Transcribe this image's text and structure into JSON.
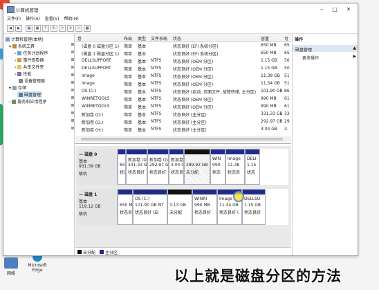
{
  "window": {
    "title": "计算机管理",
    "menu": [
      "文件(F)",
      "操作(A)",
      "查看(V)",
      "帮助(H)"
    ]
  },
  "tree": {
    "root": "计算机管理(本地)",
    "items": [
      {
        "label": "系统工具",
        "indent": 1
      },
      {
        "label": "任务计划程序",
        "indent": 2
      },
      {
        "label": "事件查看器",
        "indent": 2
      },
      {
        "label": "共享文件夹",
        "indent": 2
      },
      {
        "label": "性能",
        "indent": 2
      },
      {
        "label": "设备管理器",
        "indent": 2
      },
      {
        "label": "存储",
        "indent": 1
      },
      {
        "label": "磁盘管理",
        "indent": 2,
        "selected": true
      },
      {
        "label": "服务和应用程序",
        "indent": 1
      }
    ]
  },
  "volumes": {
    "columns": [
      "卷",
      "布局",
      "类型",
      "文件系统",
      "状态",
      "容量",
      "可"
    ],
    "rows": [
      [
        "(磁盘 0 磁盘分区 1)",
        "简单",
        "基本",
        "",
        "状态良好 (EFI 系统分区)",
        "650 MB",
        "65"
      ],
      [
        "(磁盘 1 磁盘分区 1)",
        "简单",
        "基本",
        "",
        "状态良好 (EFI 系统分区)",
        "650 MB",
        "65"
      ],
      [
        "DELLSUPPORT",
        "简单",
        "基本",
        "NTFS",
        "状态良好 (OEM 分区)",
        "1.15 GB",
        "50"
      ],
      [
        "DELLSUPPORT",
        "简单",
        "基本",
        "NTFS",
        "状态良好 (OEM 分区)",
        "1.15 GB",
        "50"
      ],
      [
        "Image",
        "简单",
        "基本",
        "NTFS",
        "状态良好 (OEM 分区)",
        "11.38 GB",
        "51"
      ],
      [
        "Image",
        "简单",
        "基本",
        "NTFS",
        "状态良好 (OEM 分区)",
        "11.34 GB",
        "51"
      ],
      [
        "OS (C:)",
        "简单",
        "基本",
        "NTFS",
        "状态良好 (启动, 页面文件, 故障转储, 主分区)",
        "101.90 GB",
        "86"
      ],
      [
        "WINRETOOLS",
        "简单",
        "基本",
        "NTFS",
        "状态良好 (OEM 分区)",
        "990 MB",
        "61"
      ],
      [
        "WINRETOOLS",
        "简单",
        "基本",
        "NTFS",
        "状态良好 (OEM 分区)",
        "990 MB",
        "61"
      ],
      [
        "新加卷 (D:)",
        "简单",
        "基本",
        "NTFS",
        "状态良好 (主分区)",
        "331.33 GB",
        "33"
      ],
      [
        "新加卷 (G:)",
        "简单",
        "基本",
        "NTFS",
        "状态良好 (主分区)",
        "292.97 GB",
        "29"
      ],
      [
        "新加卷 (H:)",
        "简单",
        "基本",
        "NTFS",
        "状态良好 (主分区)",
        "3.04 GB",
        "3."
      ]
    ]
  },
  "disks": [
    {
      "name": "磁盘 0",
      "type": "基本",
      "size": "931.39 GB",
      "status": "联机",
      "parts": [
        {
          "name": "",
          "size": "650",
          "status": "状态",
          "kind": "primary"
        },
        {
          "name": "新加卷 (D:",
          "size": "331.33 GB",
          "status": "状态良好",
          "kind": "primary"
        },
        {
          "name": "新加卷 (G:",
          "size": "292.97 GB",
          "status": "状态良好",
          "kind": "primary"
        },
        {
          "name": "新加卷",
          "size": "3.04 C",
          "status": "状态良",
          "kind": "primary"
        },
        {
          "name": "",
          "size": "289.93 GB",
          "status": "未分配",
          "kind": "unalloc"
        },
        {
          "name": "WIN",
          "size": "990",
          "status": "状态",
          "kind": "primary"
        },
        {
          "name": "Image",
          "size": "11.38",
          "status": "状态良",
          "kind": "primary"
        },
        {
          "name": "DELI",
          "size": "1.15",
          "status": "状态",
          "kind": "primary"
        }
      ]
    },
    {
      "name": "磁盘 1",
      "type": "基本",
      "size": "119.12 GB",
      "status": "联机",
      "parts": [
        {
          "name": "",
          "size": "650 M",
          "status": "状态良",
          "kind": "primary"
        },
        {
          "name": "OS (C:)",
          "size": "101.90 GB NT",
          "status": "状态良好 (启",
          "kind": "primary"
        },
        {
          "name": "",
          "size": "3.13 GB",
          "status": "未分配",
          "kind": "unalloc"
        },
        {
          "name": "WINRI",
          "size": "990 MB",
          "status": "状态良好",
          "kind": "primary"
        },
        {
          "name": "Image",
          "size": "11.34 GB",
          "status": "状态良好 (",
          "kind": "primary"
        },
        {
          "name": "DELLSU",
          "size": "1.15 GB",
          "status": "状态良好",
          "kind": "primary"
        }
      ]
    }
  ],
  "legend": [
    {
      "label": "未分配",
      "color": "#111111"
    },
    {
      "label": "主分区",
      "color": "#1f2a8c"
    }
  ],
  "actions": {
    "header": "操作",
    "section": "磁盘管理",
    "more": "更多操作"
  },
  "desktop": {
    "icons": [
      {
        "label": "网络"
      },
      {
        "label": "Microsoft Edge"
      }
    ]
  },
  "caption": "以上就是磁盘分区的方法",
  "colors": {
    "primary_partition": "#1f2a8c",
    "unallocated": "#111111",
    "accent": "#0078d7"
  }
}
